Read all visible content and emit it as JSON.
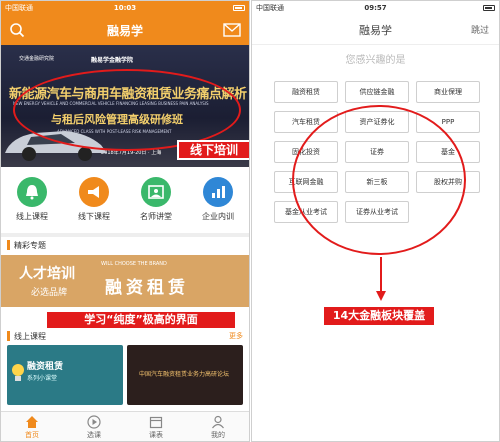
{
  "left": {
    "status": {
      "carrier": "中国联通",
      "time": "10:03",
      "battery": ""
    },
    "nav": {
      "title": "融易学"
    },
    "banner": {
      "logo1": "交通金融研究院",
      "logo2": "融易学金融学院",
      "line1": "新能源汽车与商用车融资租赁业务痛点解析",
      "sub1": "NEW ENERGY VEHICLE AND COMMERCIAL VEHICLE FINANCING LEASING BUSINESS PAIN ANALYSIS",
      "line2": "与租后风险管理高级研修班",
      "sub2": "ADVANCED CLASS WITH POST-LEASE RISK MANAGEMENT",
      "date": "2018年7月19-20日 · 上海"
    },
    "annotation_offline": "线下培训",
    "grid": [
      {
        "label": "线上课程",
        "color": "#3ab86b"
      },
      {
        "label": "线下课程",
        "color": "#f08a1c"
      },
      {
        "label": "名师讲堂",
        "color": "#3ab86b"
      },
      {
        "label": "企业内训",
        "color": "#2f87d6"
      }
    ],
    "section_featured": "精彩专题",
    "promo": {
      "p1": "人才培训",
      "p2": "必选品牌",
      "p3": "WILL CHOOSE THE BRAND",
      "p4": "融资租赁"
    },
    "annotation_purity": "学习“纯度”极高的界面",
    "section_online": "线上课程",
    "section_more": "更多",
    "cards": {
      "c1_title": "融资租赁",
      "c1_sub": "系列小课堂",
      "c2_text": "中国汽车融资租赁业务力高研论坛"
    },
    "tabs": [
      "首页",
      "选课",
      "课表",
      "我的"
    ]
  },
  "right": {
    "status": {
      "carrier": "中国联通",
      "time": "09:57",
      "battery": ""
    },
    "nav": {
      "title": "融易学",
      "skip": "跳过"
    },
    "question": "您感兴趣的是",
    "chips": [
      "融资租赁",
      "供应链金融",
      "商业保理",
      "汽车租赁",
      "资产证券化",
      "PPP",
      "固化投资",
      "证券",
      "基金",
      "互联网金融",
      "新三板",
      "股权并购",
      "基金从业考试",
      "证券从业考试"
    ],
    "annotation_14": "14大金融板块覆盖"
  },
  "colors": {
    "brand_orange": "#f08a1c",
    "annotation_red": "#e21b1b"
  }
}
